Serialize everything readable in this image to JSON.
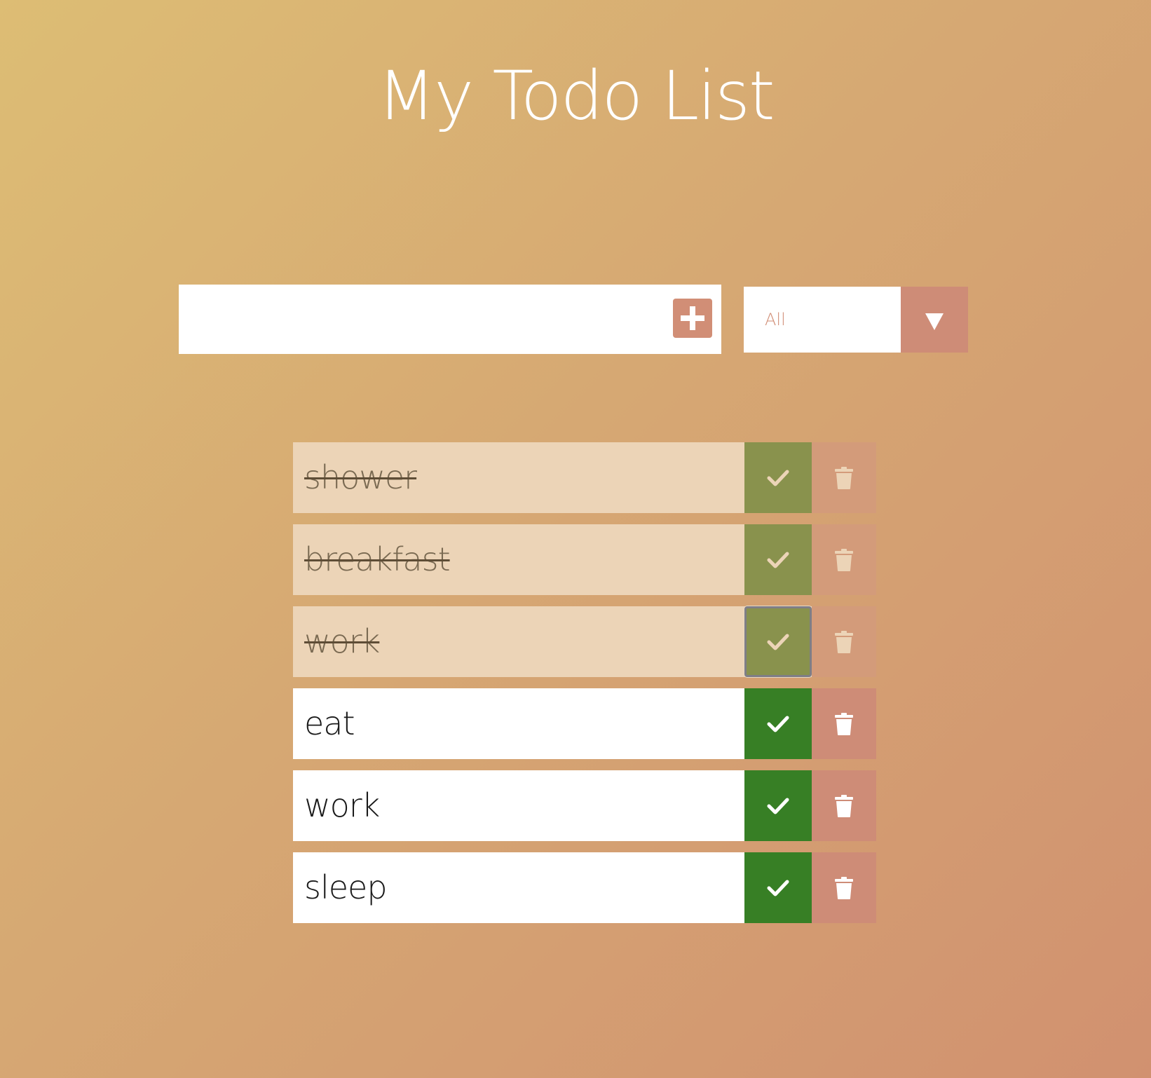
{
  "header": {
    "title": "My Todo List"
  },
  "add_form": {
    "input_value": "",
    "add_icon": "plus-square-icon"
  },
  "filter": {
    "selected": "All",
    "arrow_icon": "triangle-down-icon"
  },
  "todos": [
    {
      "text": "shower",
      "completed": true
    },
    {
      "text": "breakfast",
      "completed": true
    },
    {
      "text": "work",
      "completed": true
    },
    {
      "text": "eat",
      "completed": false
    },
    {
      "text": "work",
      "completed": false
    },
    {
      "text": "sleep",
      "completed": false
    }
  ],
  "item_icons": {
    "check": "check-icon",
    "delete": "trash-icon"
  },
  "colors": {
    "accent": "#d18e76",
    "check_active": "#377f25",
    "check_completed": "#89924d",
    "trash_active": "#ce8c77",
    "trash_completed": "#d39b7a",
    "completed_row_bg": "#ecd4b7",
    "gradient_start": "#ddbd74",
    "gradient_end": "#d19170"
  }
}
